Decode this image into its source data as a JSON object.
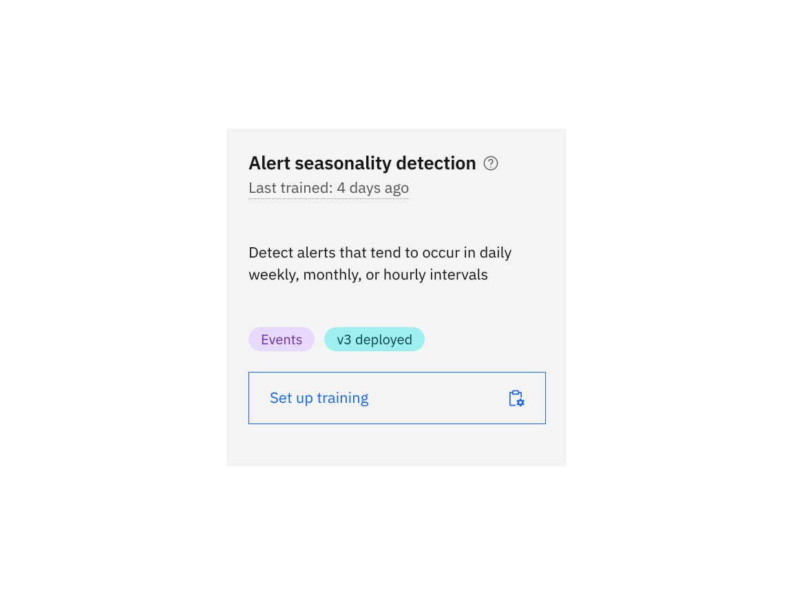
{
  "card": {
    "title": "Alert seasonality detection",
    "last_trained": "Last trained: 4 days ago",
    "description": "Detect alerts that tend to occur in daily weekly, monthly, or hourly intervals",
    "tags": {
      "events": "Events",
      "deployed": "v3 deployed"
    },
    "button_label": "Set up training"
  }
}
